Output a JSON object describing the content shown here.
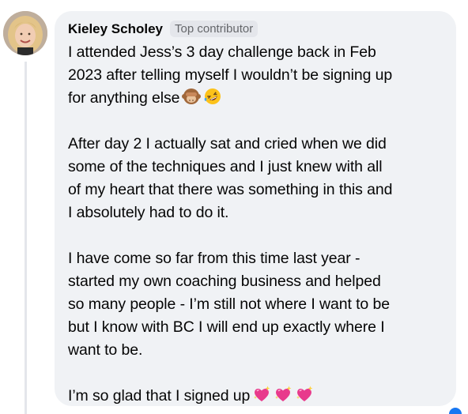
{
  "comment": {
    "author_name": "Kieley Scholey",
    "badge": "Top contributor",
    "paragraphs": [
      {
        "lines": [
          "I attended Jess’s 3 day challenge back in Feb",
          "2023 after telling myself I wouldn’t be signing up",
          "for anything else"
        ],
        "trailing_emojis": [
          "see-no-evil-monkey",
          "rofl-face"
        ]
      },
      {
        "lines": [
          "After day 2 I actually sat and cried when we did",
          "some of the techniques and I just knew with all",
          "of my heart that there was something in this and",
          "I absolutely had to do it."
        ],
        "trailing_emojis": []
      },
      {
        "lines": [
          "I have come so far from this time last year -",
          "started my own coaching business and helped",
          "so many people - I’m still not where I want to be",
          "but I know with BC I will end up exactly where I",
          "want to be."
        ],
        "trailing_emojis": []
      },
      {
        "lines": [
          "I’m so glad that I signed up"
        ],
        "trailing_emojis": [
          "sparkling-heart",
          "sparkling-heart",
          "sparkling-heart"
        ]
      }
    ]
  },
  "colors": {
    "bubble_background": "#f0f2f5",
    "text_primary": "#050505",
    "text_secondary": "#65676b",
    "badge_background": "#e4e6eb",
    "accent": "#1877f2"
  }
}
